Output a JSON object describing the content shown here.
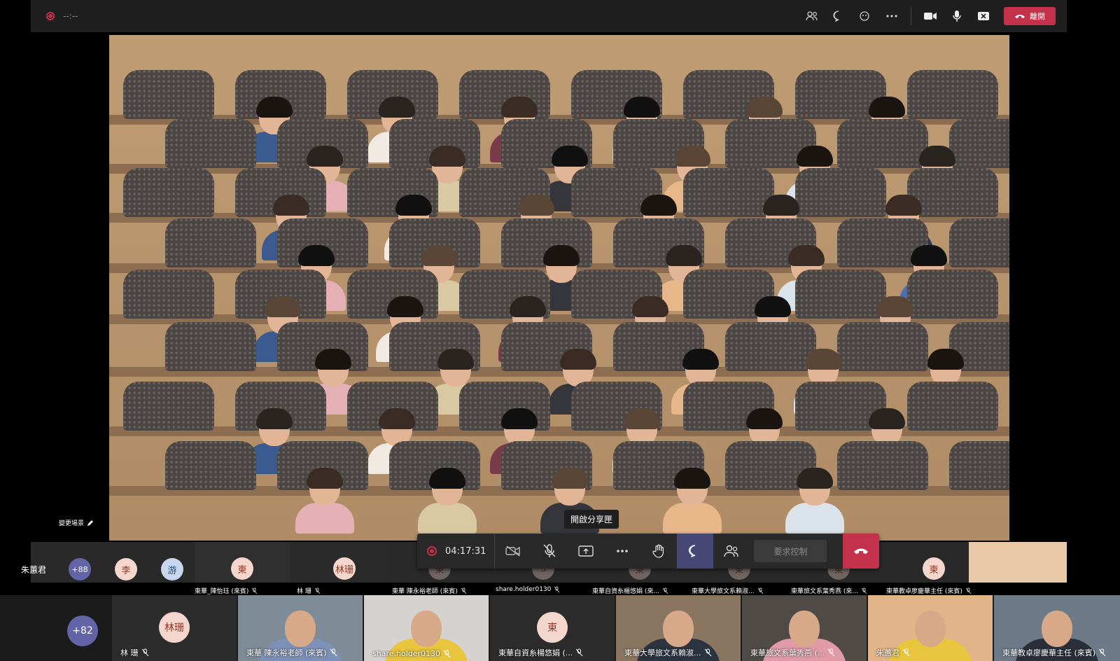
{
  "outer_bar": {
    "timer": "--:--",
    "leave_label": "離開"
  },
  "stage": {
    "change_background_label": "變更場景"
  },
  "share_tooltip": "開啟分享匣",
  "inner_strip": {
    "presenter_name": "朱蕙君",
    "more_count": "+88",
    "badge_1": "李",
    "badge_2": "游",
    "tiles": [
      {
        "initial": "東",
        "label": "東華_陳怡珏 (來賓)"
      },
      {
        "initial": "林珊",
        "label": "林 珊"
      },
      {
        "initial": "東",
        "label": "東華 陳永裕老師 (來賓)"
      },
      {
        "initial": "S",
        "label": "share.holder0130"
      },
      {
        "initial": "東",
        "label": "東華自資糸楊悠娟 (來..."
      },
      {
        "initial": "東",
        "label": "東華大學旅文系賴淑..."
      },
      {
        "initial": "東",
        "label": "東華旅文系葉秀燕 (來..."
      },
      {
        "initial": "東",
        "label": "東華教卓廖慶華主任 (來賓)"
      }
    ]
  },
  "controls": {
    "record_time": "04:17:31",
    "request_control_label": "要求控制"
  },
  "bottom_strip": {
    "more_count": "+82",
    "tiles": [
      {
        "type": "avatar",
        "initials": "林珊",
        "label": "林 珊"
      },
      {
        "type": "video",
        "label": "東華 陳永裕老師 (來賓)"
      },
      {
        "type": "video",
        "label": "share.holder0130"
      },
      {
        "type": "avatar",
        "initials": "東",
        "label": "東華自資糸楊悠娟 (..."
      },
      {
        "type": "video",
        "label": "東華大學旅文系賴淑..."
      },
      {
        "type": "video",
        "label": "東華旅文系葉秀燕 (..."
      },
      {
        "type": "video",
        "label": "朱蕙君"
      },
      {
        "type": "video",
        "label": "東華教卓廖慶華主任 (來賓)"
      }
    ]
  },
  "colors": {
    "accent_red": "#c4314b",
    "teams_purple": "#6264a7",
    "active_button": "#464775"
  }
}
